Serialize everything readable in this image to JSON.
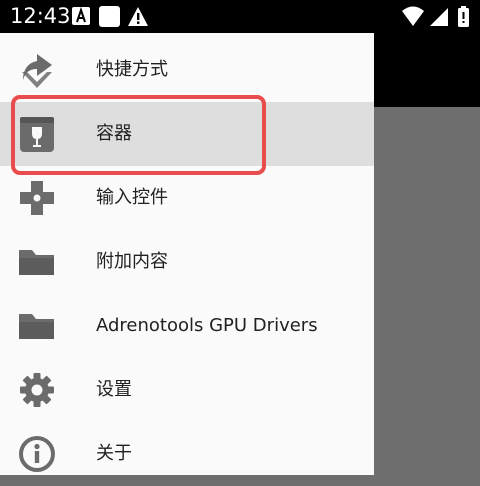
{
  "status_bar": {
    "time": "12:43",
    "left_icons": [
      "a-badge-icon",
      "square-notification-icon",
      "warning-icon"
    ],
    "right_icons": [
      "wifi-icon",
      "cell-signal-icon",
      "battery-icon"
    ]
  },
  "drawer": {
    "items": [
      {
        "label": "快捷方式",
        "icon": "shortcut-icon"
      },
      {
        "label": "容器",
        "icon": "container-icon",
        "selected": true
      },
      {
        "label": "输入控件",
        "icon": "dpad-icon"
      },
      {
        "label": "附加内容",
        "icon": "folder-icon"
      },
      {
        "label": "Adrenotools GPU Drivers",
        "icon": "folder-icon"
      },
      {
        "label": "设置",
        "icon": "gear-icon"
      },
      {
        "label": "关于",
        "icon": "info-icon"
      }
    ]
  },
  "colors": {
    "drawer_bg": "#fafafa",
    "selected_bg": "#dedede",
    "icon_gray": "#6b6b6b",
    "highlight_red": "#e94c4c",
    "scrim": "#6e6e6e"
  }
}
